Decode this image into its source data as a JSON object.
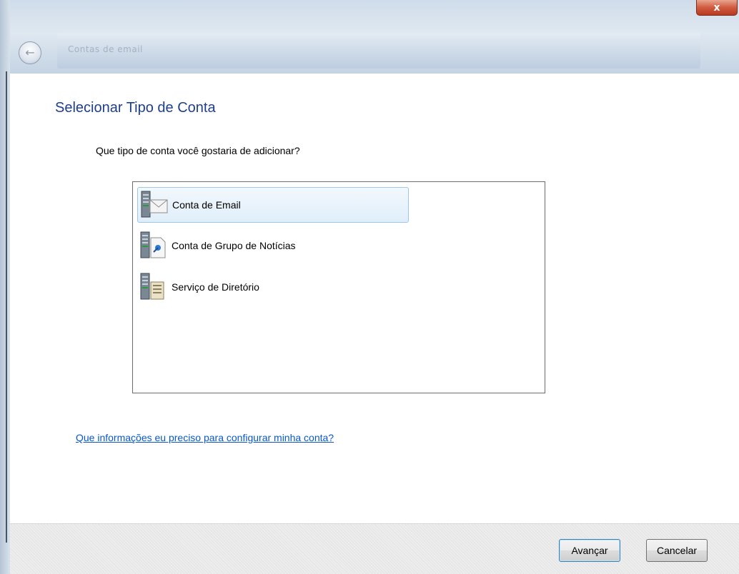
{
  "window": {
    "title": "Contas de email",
    "close_label": "x"
  },
  "page": {
    "title": "Selecionar Tipo de Conta",
    "question": "Que tipo de conta você gostaria de adicionar?"
  },
  "account_types": [
    {
      "label": "Conta de Email",
      "icon": "server-mail-icon",
      "selected": true
    },
    {
      "label": "Conta de Grupo de Notícias",
      "icon": "server-news-icon",
      "selected": false
    },
    {
      "label": "Serviço de Diretório",
      "icon": "server-directory-icon",
      "selected": false
    }
  ],
  "help_link": "Que informações eu preciso para configurar minha conta?",
  "buttons": {
    "next": "Avançar",
    "cancel": "Cancelar"
  },
  "colors": {
    "title": "#1e3f8c",
    "link": "#0a58c8",
    "selection_border": "#9cc6ea"
  }
}
